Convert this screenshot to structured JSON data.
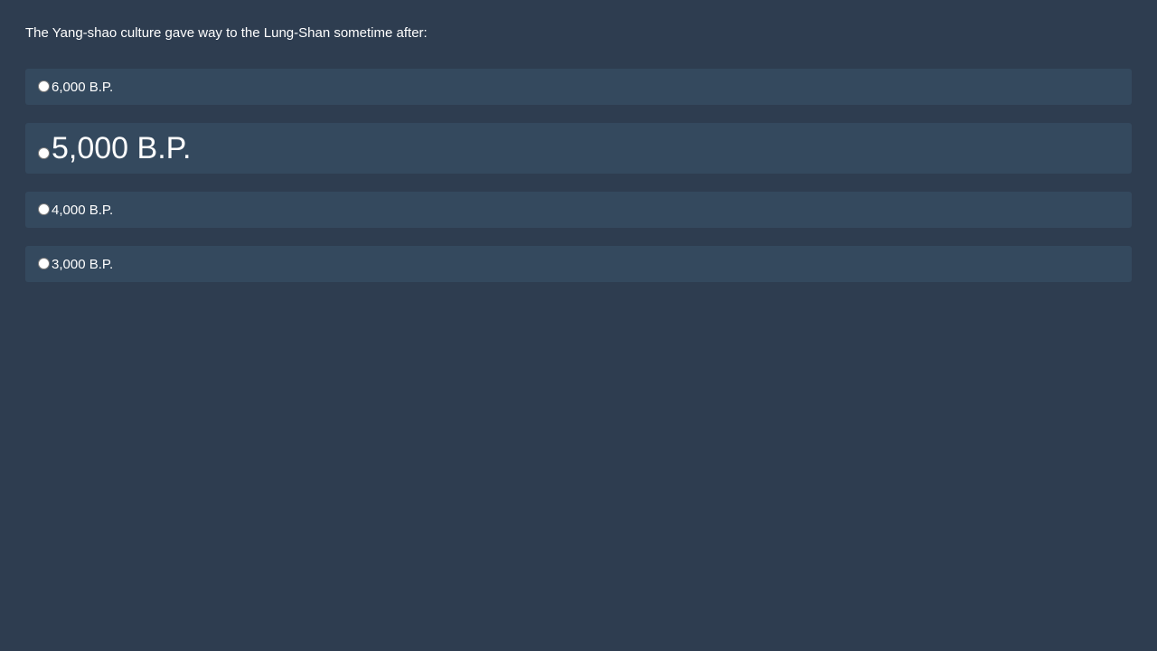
{
  "question": {
    "text": "The Yang-shao culture gave way to the Lung-Shan sometime after:"
  },
  "options": [
    {
      "label": "6,000 B.P."
    },
    {
      "label": "5,000 B.P."
    },
    {
      "label": "4,000 B.P."
    },
    {
      "label": "3,000 B.P."
    }
  ],
  "colors": {
    "background": "#2e3d50",
    "option_background": "#34495e",
    "text": "#ffffff"
  }
}
